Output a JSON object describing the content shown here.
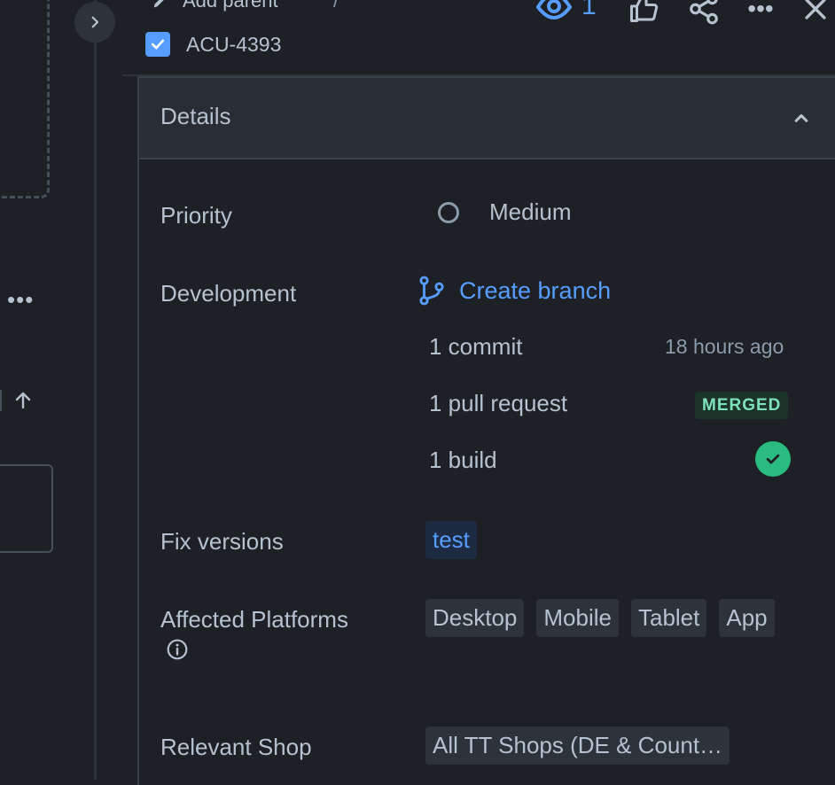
{
  "left_pane": {
    "more_icon": "more-horizontal-icon"
  },
  "header": {
    "add_parent": "Add parent",
    "separator": "/",
    "issue_key": "ACU-4393",
    "watch_count": "1"
  },
  "details": {
    "title": "Details",
    "priority": {
      "label": "Priority",
      "value": "Medium"
    },
    "development": {
      "label": "Development",
      "create_branch": "Create branch",
      "commit": "1 commit",
      "commit_time": "18 hours ago",
      "pull_request": "1 pull request",
      "pr_status": "MERGED",
      "build": "1 build"
    },
    "fix_versions": {
      "label": "Fix versions",
      "value": "test"
    },
    "affected_platforms": {
      "label": "Affected Platforms",
      "values": [
        "Desktop",
        "Mobile",
        "Tablet",
        "App"
      ]
    },
    "relevant_shop": {
      "label": "Relevant Shop",
      "value": "All TT Shops (DE & Count…"
    }
  },
  "colors": {
    "background": "#1d2125",
    "link": "#579dff",
    "success": "#2abb7f",
    "merged_text": "#7ee2b8"
  }
}
